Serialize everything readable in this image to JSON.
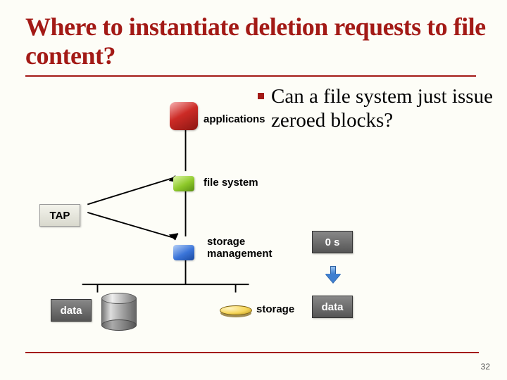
{
  "title": "Where to instantiate deletion requests to file content?",
  "bullet": "Can a file system just issue zeroed blocks?",
  "labels": {
    "applications": "applications",
    "file_system": "file system",
    "storage_management": "storage\nmanagement",
    "storage": "storage"
  },
  "boxes": {
    "tap": "TAP",
    "data": "data",
    "zeros": "0 s",
    "data2": "data"
  },
  "page_number": "32"
}
